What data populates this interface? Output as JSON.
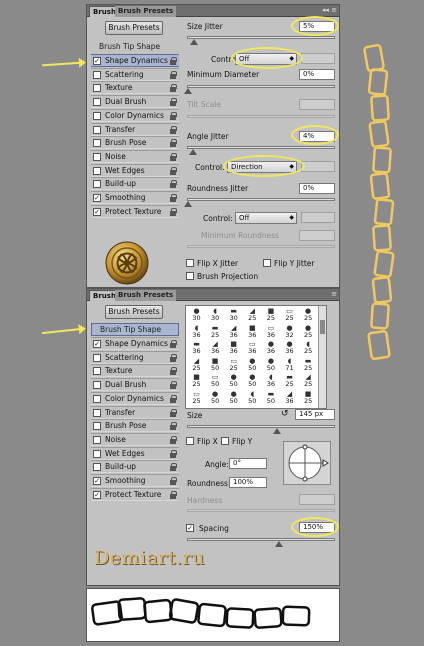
{
  "top_panel": {
    "tabs": [
      "Brush",
      "Brush Presets"
    ],
    "brush_presets_button": "Brush Presets",
    "brush_tip_shape": "Brush Tip Shape",
    "items": [
      {
        "label": "Shape Dynamics",
        "checked": true,
        "selected": true
      },
      {
        "label": "Scattering",
        "checked": false
      },
      {
        "label": "Texture",
        "checked": false
      },
      {
        "label": "Dual Brush",
        "checked": false
      },
      {
        "label": "Color Dynamics",
        "checked": false
      },
      {
        "label": "Transfer",
        "checked": false
      },
      {
        "label": "Brush Pose",
        "checked": false
      },
      {
        "label": "Noise",
        "checked": false
      },
      {
        "label": "Wet Edges",
        "checked": false
      },
      {
        "label": "Build-up",
        "checked": false
      },
      {
        "label": "Smoothing",
        "checked": true
      },
      {
        "label": "Protect Texture",
        "checked": true
      }
    ],
    "size_jitter_label": "Size Jitter",
    "size_jitter_value": "5%",
    "control_label": "Control:",
    "control1_value": "Off",
    "min_diameter_label": "Minimum Diameter",
    "min_diameter_value": "0%",
    "tilt_scale_label": "Tilt Scale",
    "angle_jitter_label": "Angle Jitter",
    "angle_jitter_value": "4%",
    "control2_value": "Direction",
    "roundness_jitter_label": "Roundness Jitter",
    "roundness_jitter_value": "0%",
    "control3_value": "Off",
    "min_roundness_label": "Minimum Roundness",
    "flip_x_jitter": "Flip X Jitter",
    "flip_y_jitter": "Flip Y Jitter",
    "brush_projection": "Brush Projection"
  },
  "bottom_panel": {
    "tabs": [
      "Brush",
      "Brush Presets"
    ],
    "brush_presets_button": "Brush Presets",
    "brush_tip_shape": "Brush Tip Shape",
    "items": [
      {
        "label": "Shape Dynamics",
        "checked": true
      },
      {
        "label": "Scattering",
        "checked": false
      },
      {
        "label": "Texture",
        "checked": false
      },
      {
        "label": "Dual Brush",
        "checked": false
      },
      {
        "label": "Color Dynamics",
        "checked": false
      },
      {
        "label": "Transfer",
        "checked": false
      },
      {
        "label": "Brush Pose",
        "checked": false
      },
      {
        "label": "Noise",
        "checked": false
      },
      {
        "label": "Wet Edges",
        "checked": false
      },
      {
        "label": "Build-up",
        "checked": false
      },
      {
        "label": "Smoothing",
        "checked": true
      },
      {
        "label": "Protect Texture",
        "checked": true
      }
    ],
    "tip_grid": [
      [
        "30",
        "30",
        "30",
        "25",
        "25",
        "25",
        "25"
      ],
      [
        "36",
        "25",
        "36",
        "36",
        "36",
        "32",
        "25"
      ],
      [
        "36",
        "36",
        "36",
        "36",
        "36",
        "36",
        "25"
      ],
      [
        "25",
        "50",
        "25",
        "50",
        "50",
        "71",
        "25"
      ],
      [
        "25",
        "50",
        "50",
        "50",
        "36",
        "25",
        "25"
      ],
      [
        "25",
        "50",
        "50",
        "50",
        "50",
        "36",
        "25"
      ]
    ],
    "size_label": "Size",
    "size_value": "145 px",
    "flip_x": "Flip X",
    "flip_y": "Flip Y",
    "angle_label": "Angle:",
    "angle_value": "0°",
    "roundness_label": "Roundness:",
    "roundness_value": "100%",
    "hardness_label": "Hardness",
    "spacing_label": "Spacing",
    "spacing_value": "150%"
  },
  "watermark": "Demiart.ru",
  "colors": {
    "highlight": "#f2e65c",
    "selected_row": "#aab6cf",
    "panel": "#c2c2c2",
    "chain_right": "#f0c860"
  }
}
